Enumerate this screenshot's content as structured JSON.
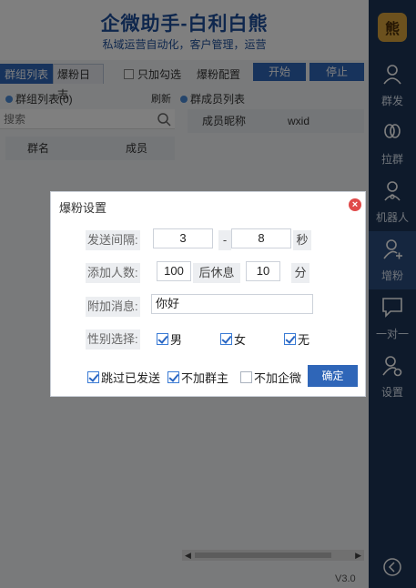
{
  "app": {
    "title": "企微助手-白利白熊",
    "subtitle": "私域运营自动化，客户管理，运营",
    "version": "V3.0"
  },
  "tabs": [
    {
      "label": "群组列表",
      "active": true
    },
    {
      "label": "爆粉日志",
      "active": false
    }
  ],
  "toolbar": {
    "only_checked_label": "只加勾选",
    "config_label": "爆粉配置",
    "start_label": "开始",
    "stop_label": "停止"
  },
  "group_panel": {
    "title": "群组列表(0)",
    "refresh_label": "刷新",
    "search_placeholder": "搜索",
    "columns": [
      "群名",
      "成员"
    ]
  },
  "member_panel": {
    "title": "群成员列表",
    "columns": [
      "成员昵称",
      "wxid"
    ]
  },
  "sidebar": {
    "logo_text": "熊",
    "items": [
      {
        "label": "群发",
        "icon": "user-send-icon"
      },
      {
        "label": "拉群",
        "icon": "link-icon"
      },
      {
        "label": "机器人",
        "icon": "robot-icon"
      },
      {
        "label": "增粉",
        "icon": "add-user-icon"
      },
      {
        "label": "一对一",
        "icon": "chat-icon"
      },
      {
        "label": "设置",
        "icon": "settings-icon"
      }
    ]
  },
  "dialog": {
    "title": "爆粉设置",
    "interval_label": "发送间隔:",
    "interval_min": "3",
    "interval_sep": "-",
    "interval_max": "8",
    "interval_unit": "秒",
    "add_label": "添加人数:",
    "add_count": "100",
    "rest_label": "后休息",
    "rest_minutes": "10",
    "rest_unit": "分",
    "message_label": "附加消息:",
    "message_value": "你好",
    "gender_label": "性别选择:",
    "gender_options": [
      {
        "label": "男",
        "checked": true
      },
      {
        "label": "女",
        "checked": true
      },
      {
        "label": "无",
        "checked": true
      }
    ],
    "skip_sent_label": "跳过已发送",
    "skip_sent_checked": true,
    "no_owner_label": "不加群主",
    "no_owner_checked": true,
    "no_wecom_label": "不加企微",
    "no_wecom_checked": false,
    "confirm_label": "确定"
  },
  "colors": {
    "accent": "#2f66b8",
    "sidebar_bg": "#1d3556",
    "title": "#1f4f9a",
    "close": "#e04a4a"
  }
}
